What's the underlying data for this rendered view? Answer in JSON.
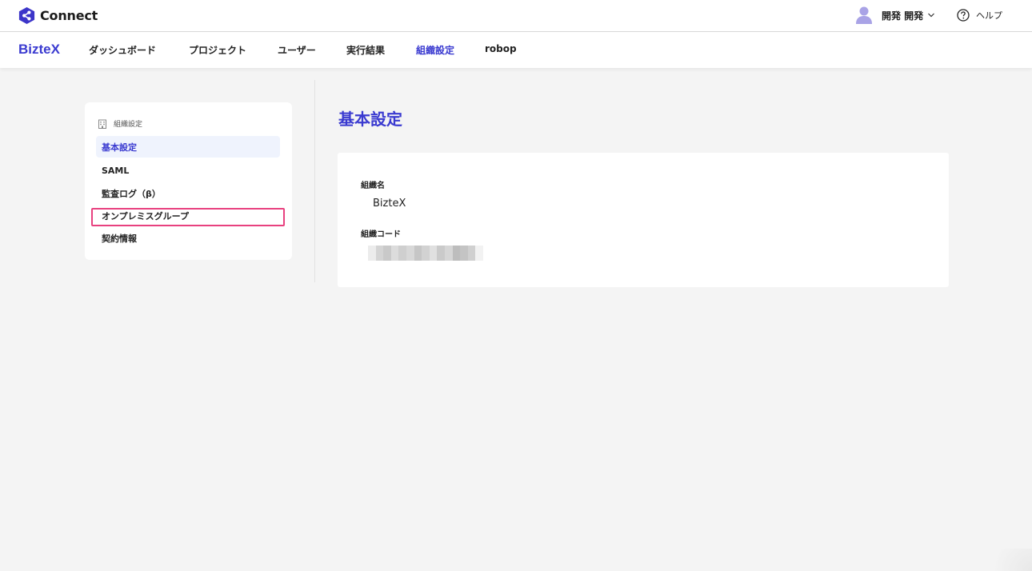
{
  "app": {
    "name": "Connect",
    "brand": "BizteX",
    "accent_color": "#3a3ad0",
    "logo_color": "#3c35c9"
  },
  "header": {
    "user_name": "開発 開発",
    "help_label": "ヘルプ",
    "icons": {
      "avatar": "user-avatar-icon",
      "chevron": "chevron-down-icon",
      "help": "question-circle-icon"
    }
  },
  "nav": {
    "items": [
      {
        "label": "ダッシュボード",
        "active": false
      },
      {
        "label": "プロジェクト",
        "active": false
      },
      {
        "label": "ユーザー",
        "active": false
      },
      {
        "label": "実行結果",
        "active": false
      },
      {
        "label": "組織設定",
        "active": true
      },
      {
        "label": "robop",
        "active": false
      }
    ]
  },
  "sidebar": {
    "heading": "組織設定",
    "heading_icon": "building-icon",
    "items": [
      {
        "label": "基本設定",
        "active": true
      },
      {
        "label": "SAML",
        "active": false
      },
      {
        "label": "監査ログ（β）",
        "active": false
      },
      {
        "label": "オンプレミスグループ",
        "active": false,
        "highlighted": true
      },
      {
        "label": "契約情報",
        "active": false
      }
    ],
    "highlight_color": "#e8417f"
  },
  "main": {
    "title": "基本設定",
    "fields": [
      {
        "label": "組織名",
        "value": "BizteX"
      },
      {
        "label": "組織コード",
        "value": ""
      }
    ]
  }
}
